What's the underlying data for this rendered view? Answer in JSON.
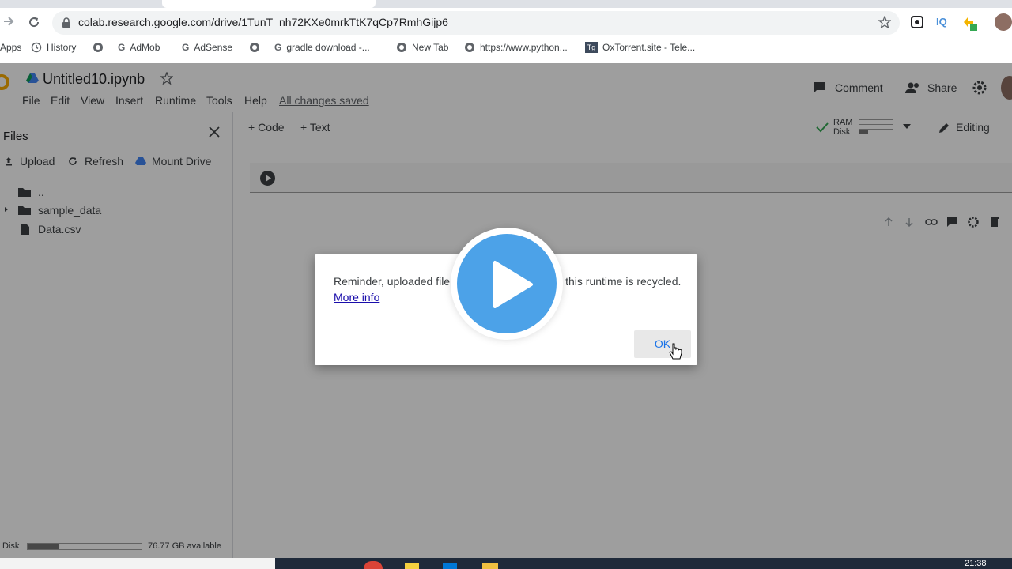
{
  "browser": {
    "url": "colab.research.google.com/drive/1TunT_nh72KXe0mrkTtK7qCp7RmhGijp6",
    "extension_label": "IQ",
    "bookmarks": [
      {
        "label": "Apps",
        "icon": "apps-grid-icon"
      },
      {
        "label": "History",
        "icon": "history-icon"
      },
      {
        "label": "",
        "icon": "globe-icon"
      },
      {
        "label": "AdMob",
        "icon": "google-g-icon"
      },
      {
        "label": "AdSense",
        "icon": "google-g-icon"
      },
      {
        "label": "",
        "icon": "globe-icon"
      },
      {
        "label": "gradle download -...",
        "icon": "google-g-icon"
      },
      {
        "label": "New Tab",
        "icon": "globe-icon"
      },
      {
        "label": "https://www.python...",
        "icon": "globe-icon"
      },
      {
        "label": "OxTorrent.site - Tele...",
        "icon": "tg-icon"
      }
    ]
  },
  "colab": {
    "notebook_title": "Untitled10.ipynb",
    "menu": [
      "File",
      "Edit",
      "View",
      "Insert",
      "Runtime",
      "Tools",
      "Help"
    ],
    "save_status": "All changes saved",
    "comment_label": "Comment",
    "share_label": "Share",
    "toolbar": {
      "code_label": "Code",
      "text_label": "Text",
      "ram_label": "RAM",
      "disk_label": "Disk",
      "editing_label": "Editing"
    },
    "files_panel": {
      "title": "Files",
      "upload_label": "Upload",
      "refresh_label": "Refresh",
      "mount_label": "Mount Drive",
      "items": [
        {
          "label": "..",
          "icon": "folder-up-icon"
        },
        {
          "label": "sample_data",
          "icon": "folder-icon"
        },
        {
          "label": "Data.csv",
          "icon": "file-icon"
        }
      ],
      "disk_label": "Disk",
      "disk_available": "76.77 GB available",
      "disk_fill_fraction": 0.28
    }
  },
  "dialog": {
    "message_left": "Reminder, uploaded file",
    "message_right": "this runtime is recycled.",
    "link": "More info",
    "ok": "OK"
  },
  "taskbar": {
    "time": "21:38"
  },
  "colors": {
    "accent": "#1a73e8",
    "play": "#4ca2e8",
    "overlay": "rgba(0,0,0,0.38)"
  }
}
